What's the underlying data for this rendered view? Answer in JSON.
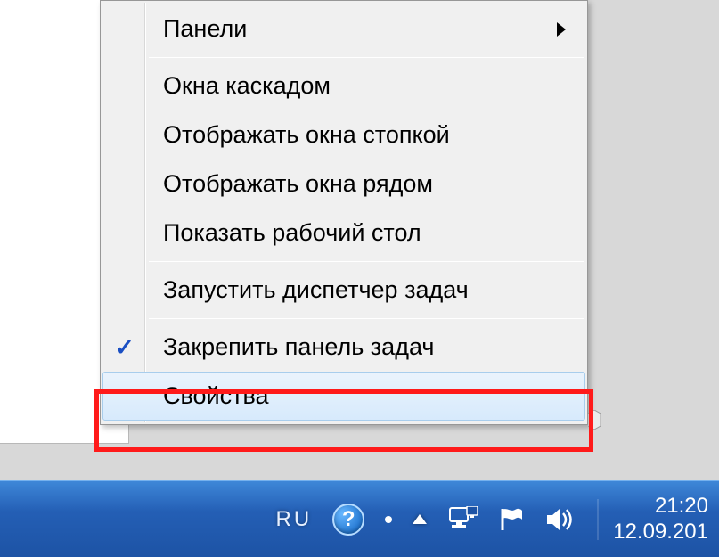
{
  "context_menu": {
    "items": {
      "panels": "Панели",
      "cascade": "Окна каскадом",
      "stack": "Отображать окна стопкой",
      "sidebyside": "Отображать окна рядом",
      "show_desktop": "Показать рабочий стол",
      "task_manager": "Запустить диспетчер задач",
      "lock_taskbar": "Закрепить панель задач",
      "properties": "Свойства"
    }
  },
  "systray": {
    "language": "RU",
    "help_glyph": "?",
    "clock": {
      "time": "21:20",
      "date": "12.09.201"
    }
  }
}
